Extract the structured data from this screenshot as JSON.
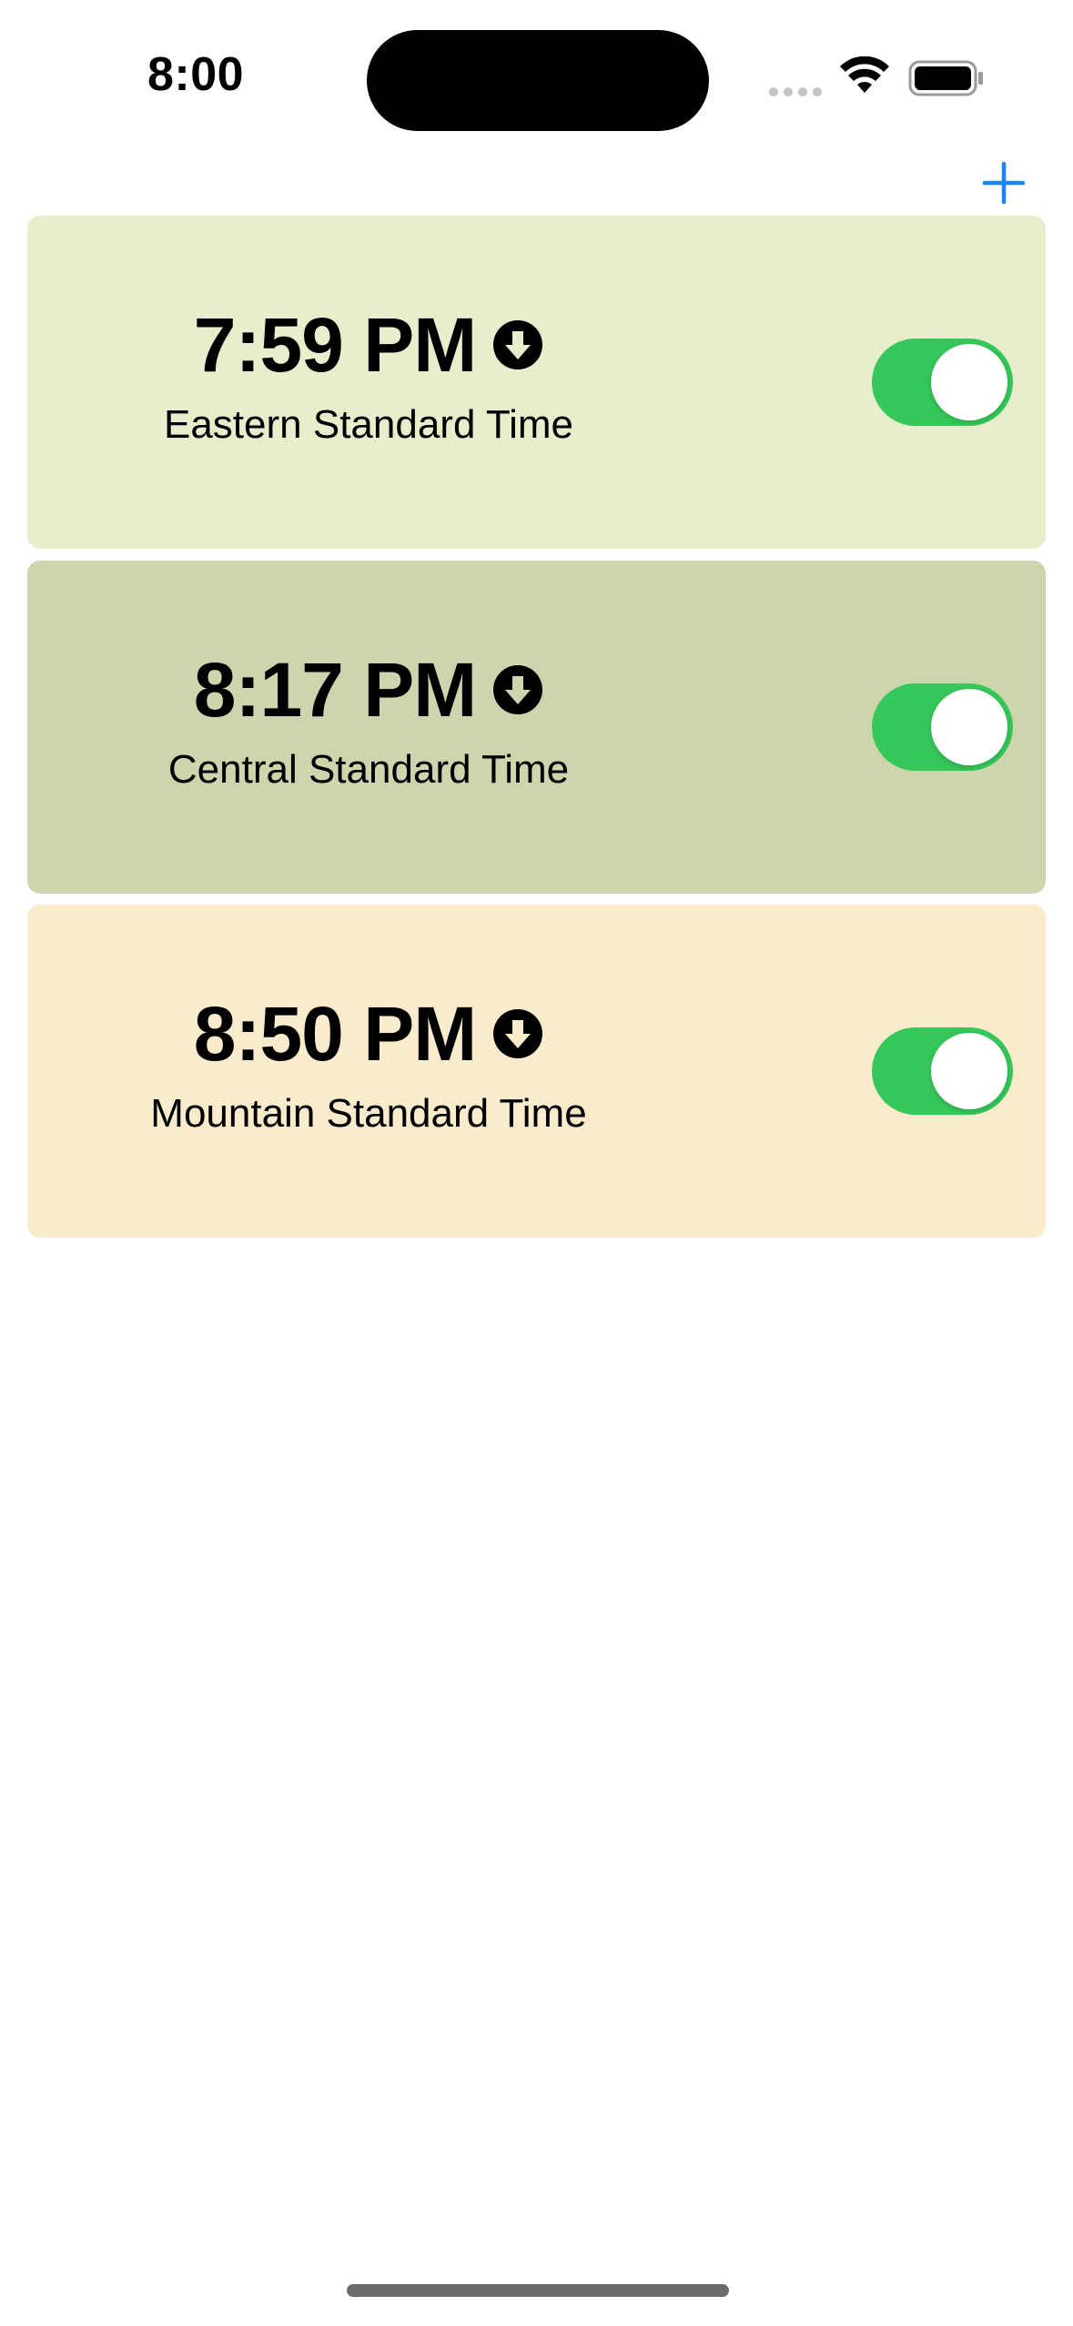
{
  "status_bar": {
    "time": "8:00"
  },
  "colors": {
    "accent": "#1a84ff",
    "toggle_on": "#35c759",
    "card_1_bg": "#e8edcc",
    "card_2_bg": "#cdd5ad",
    "card_3_bg": "#f9ebcc"
  },
  "toolbar": {
    "add_icon": "plus-icon"
  },
  "clocks": [
    {
      "time": "7:59 PM",
      "zone": "Eastern Standard Time",
      "icon": "arrow-down-circle-icon",
      "enabled": true
    },
    {
      "time": "8:17 PM",
      "zone": "Central Standard Time",
      "icon": "arrow-down-circle-icon",
      "enabled": true
    },
    {
      "time": "8:50 PM",
      "zone": "Mountain Standard Time",
      "icon": "arrow-down-circle-icon",
      "enabled": true
    }
  ]
}
